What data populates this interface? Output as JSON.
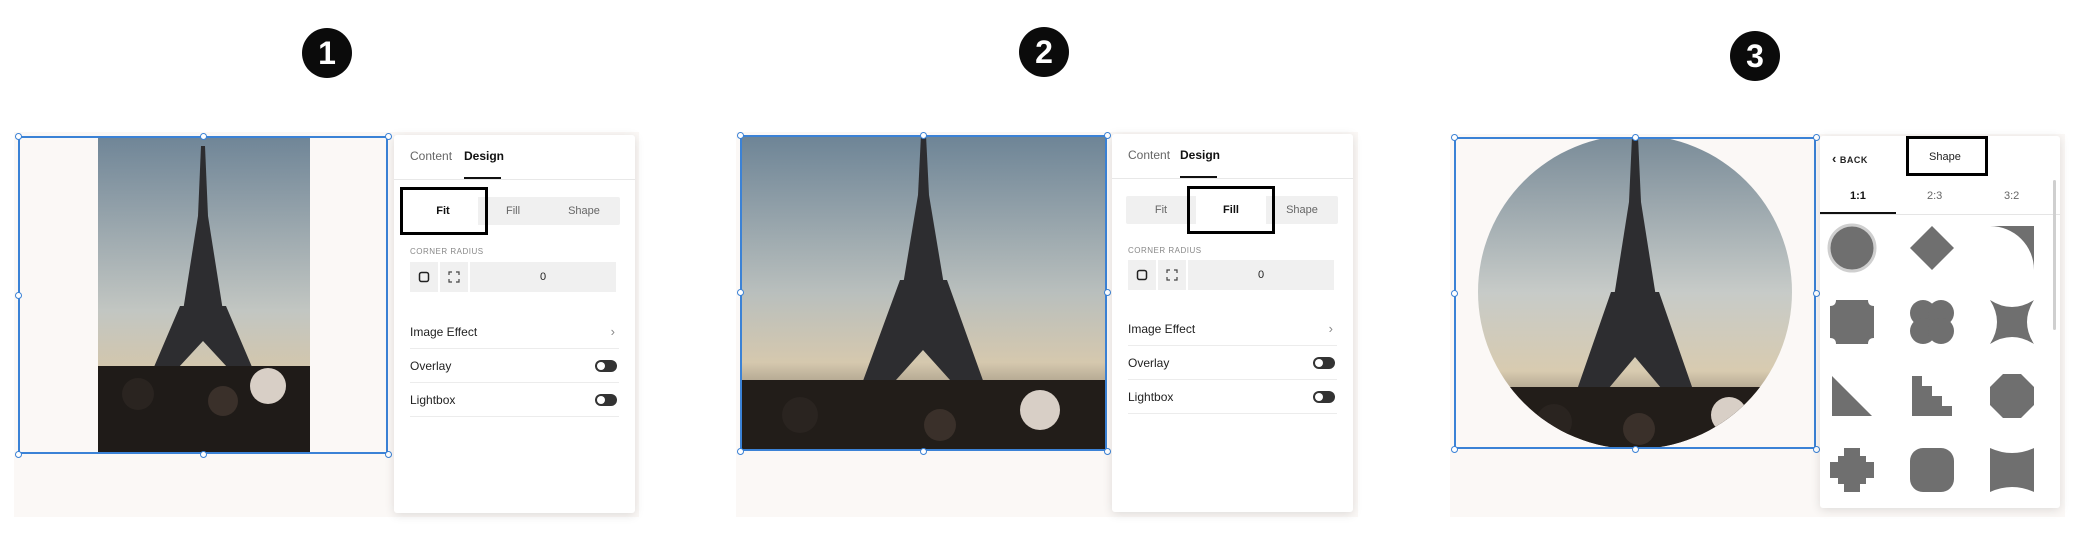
{
  "steps": [
    "1",
    "2",
    "3"
  ],
  "panel_tabs": {
    "content": "Content",
    "design": "Design"
  },
  "modes": {
    "fit": "Fit",
    "fill": "Fill",
    "shape": "Shape"
  },
  "corner_radius": {
    "label": "CORNER RADIUS",
    "value": "0"
  },
  "rows": {
    "image_effect": "Image Effect",
    "overlay": "Overlay",
    "lightbox": "Lightbox"
  },
  "toggles": {
    "overlay": "off",
    "lightbox": "off"
  },
  "shape_panel": {
    "back_label": "BACK",
    "title": "Shape",
    "ratios": [
      "1:1",
      "2:3",
      "3:2"
    ],
    "selected_ratio": "1:1",
    "shapes": [
      "circle",
      "diamond",
      "quarter-circle",
      "notched-square",
      "quatrefoil",
      "concave-star",
      "right-triangle",
      "staircase",
      "octagon",
      "cross",
      "rounded-square",
      "bowtie"
    ]
  },
  "colors": {
    "selection": "#3b82d6",
    "shape_fill": "#6f6f6f",
    "highlight": "#000000"
  }
}
